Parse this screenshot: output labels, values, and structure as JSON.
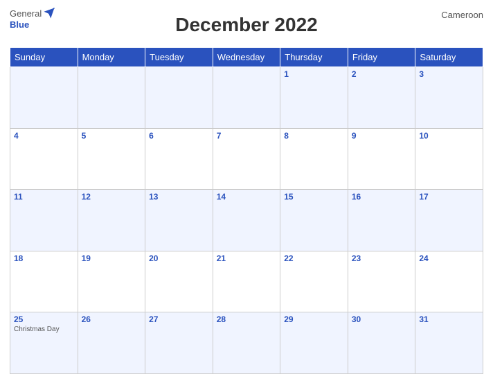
{
  "header": {
    "title": "December 2022",
    "country": "Cameroon",
    "logo_general": "General",
    "logo_blue": "Blue"
  },
  "weekdays": [
    "Sunday",
    "Monday",
    "Tuesday",
    "Wednesday",
    "Thursday",
    "Friday",
    "Saturday"
  ],
  "weeks": [
    [
      {
        "date": "",
        "event": ""
      },
      {
        "date": "",
        "event": ""
      },
      {
        "date": "",
        "event": ""
      },
      {
        "date": "",
        "event": ""
      },
      {
        "date": "1",
        "event": ""
      },
      {
        "date": "2",
        "event": ""
      },
      {
        "date": "3",
        "event": ""
      }
    ],
    [
      {
        "date": "4",
        "event": ""
      },
      {
        "date": "5",
        "event": ""
      },
      {
        "date": "6",
        "event": ""
      },
      {
        "date": "7",
        "event": ""
      },
      {
        "date": "8",
        "event": ""
      },
      {
        "date": "9",
        "event": ""
      },
      {
        "date": "10",
        "event": ""
      }
    ],
    [
      {
        "date": "11",
        "event": ""
      },
      {
        "date": "12",
        "event": ""
      },
      {
        "date": "13",
        "event": ""
      },
      {
        "date": "14",
        "event": ""
      },
      {
        "date": "15",
        "event": ""
      },
      {
        "date": "16",
        "event": ""
      },
      {
        "date": "17",
        "event": ""
      }
    ],
    [
      {
        "date": "18",
        "event": ""
      },
      {
        "date": "19",
        "event": ""
      },
      {
        "date": "20",
        "event": ""
      },
      {
        "date": "21",
        "event": ""
      },
      {
        "date": "22",
        "event": ""
      },
      {
        "date": "23",
        "event": ""
      },
      {
        "date": "24",
        "event": ""
      }
    ],
    [
      {
        "date": "25",
        "event": "Christmas Day"
      },
      {
        "date": "26",
        "event": ""
      },
      {
        "date": "27",
        "event": ""
      },
      {
        "date": "28",
        "event": ""
      },
      {
        "date": "29",
        "event": ""
      },
      {
        "date": "30",
        "event": ""
      },
      {
        "date": "31",
        "event": ""
      }
    ]
  ]
}
